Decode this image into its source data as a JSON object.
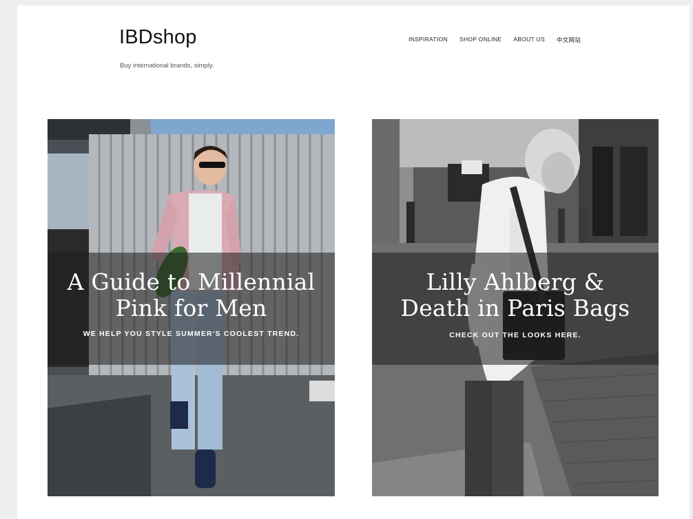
{
  "header": {
    "logo": "IBDshop",
    "tagline": "Buy international brands, simply."
  },
  "nav": {
    "items": [
      {
        "label": "INSPIRATION"
      },
      {
        "label": "SHOP ONLINE"
      },
      {
        "label": "ABOUT US"
      },
      {
        "label": "中文网站"
      }
    ]
  },
  "cards": [
    {
      "headline": "A Guide to Millennial\nPink for Men",
      "subtitle": "WE HELP YOU STYLE SUMMER'S COOLEST TREND."
    },
    {
      "headline": "Lilly Ahlberg &\nDeath in Paris Bags",
      "subtitle": "CHECK OUT THE LOOKS HERE."
    }
  ],
  "colors": {
    "page_bg": "#ffffff",
    "overlay": "#1e1e1e",
    "jacket_pink": "#d9aab4",
    "jeans_blue": "#a9c2d9"
  }
}
